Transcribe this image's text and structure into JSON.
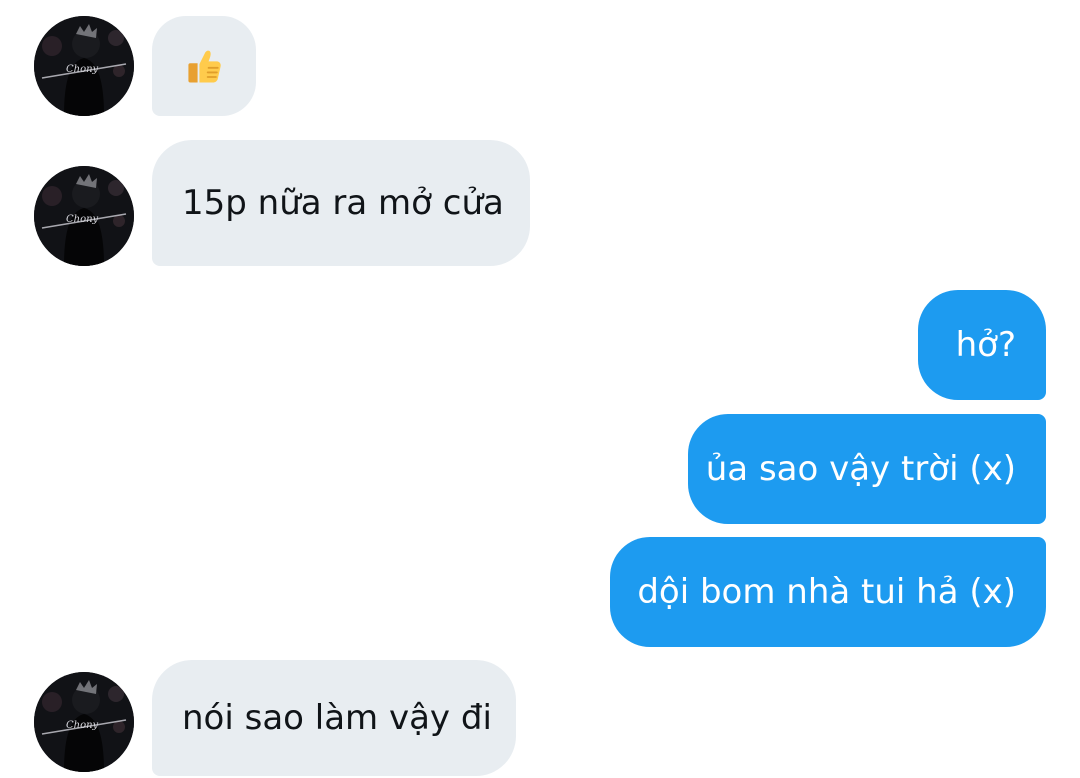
{
  "colors": {
    "incoming_bubble": "#e8edf1",
    "outgoing_bubble": "#1d9bf0",
    "incoming_text": "#101418",
    "outgoing_text": "#ffffff"
  },
  "messages": [
    {
      "direction": "incoming",
      "type": "emoji",
      "icon": "thumbs-up-icon"
    },
    {
      "direction": "incoming",
      "type": "text",
      "text": "15p nữa ra mở cửa"
    },
    {
      "direction": "outgoing",
      "type": "text",
      "text": "hở?"
    },
    {
      "direction": "outgoing",
      "type": "text",
      "text": "ủa sao vậy trời (x)"
    },
    {
      "direction": "outgoing",
      "type": "text",
      "text": "dội bom nhà tui hả (x)"
    },
    {
      "direction": "incoming",
      "type": "text",
      "text": "nói sao làm vậy đi"
    }
  ]
}
